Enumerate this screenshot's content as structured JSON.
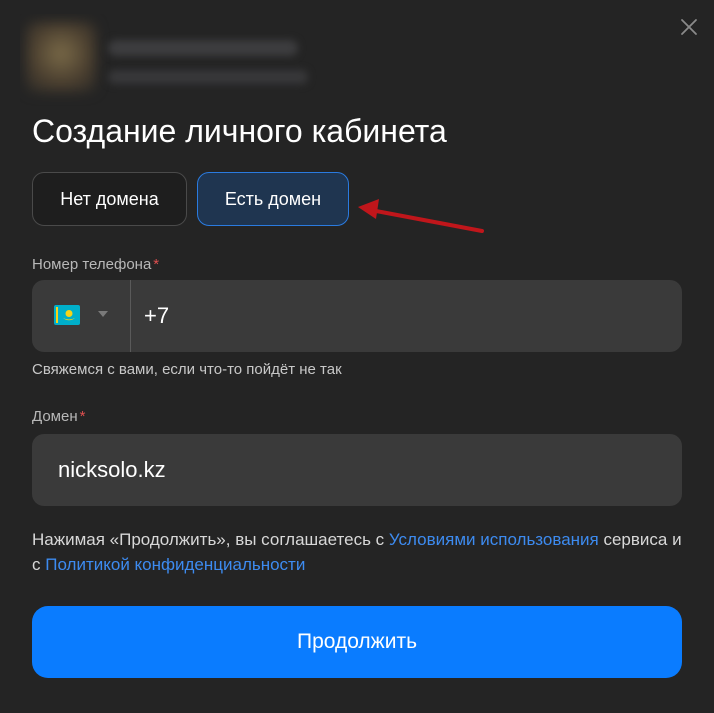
{
  "modal": {
    "title": "Создание личного кабинета",
    "close_icon": "close-icon"
  },
  "tabs": [
    {
      "label": "Нет домена",
      "selected": false
    },
    {
      "label": "Есть домен",
      "selected": true
    }
  ],
  "phone": {
    "label": "Номер телефона",
    "required_mark": "*",
    "country_flag": "kazakhstan-flag-icon",
    "value": "+7",
    "hint": "Свяжемся с вами, если что-то пойдёт не так"
  },
  "domain": {
    "label": "Домен",
    "required_mark": "*",
    "value": "nicksolo.kz"
  },
  "consent": {
    "text_before": "Нажимая «Продолжить», вы соглашаетесь с ",
    "terms_link": "Условиями использования",
    "text_middle": " сервиса и с ",
    "privacy_link": "Политикой конфиденциальности"
  },
  "continue_button": {
    "label": "Продолжить"
  },
  "colors": {
    "background": "#242424",
    "accent": "#0a7cff",
    "selected_tab_border": "#2a7be0",
    "link": "#3d8bf0",
    "annotation_arrow": "#c0161b",
    "required": "#e05050"
  }
}
